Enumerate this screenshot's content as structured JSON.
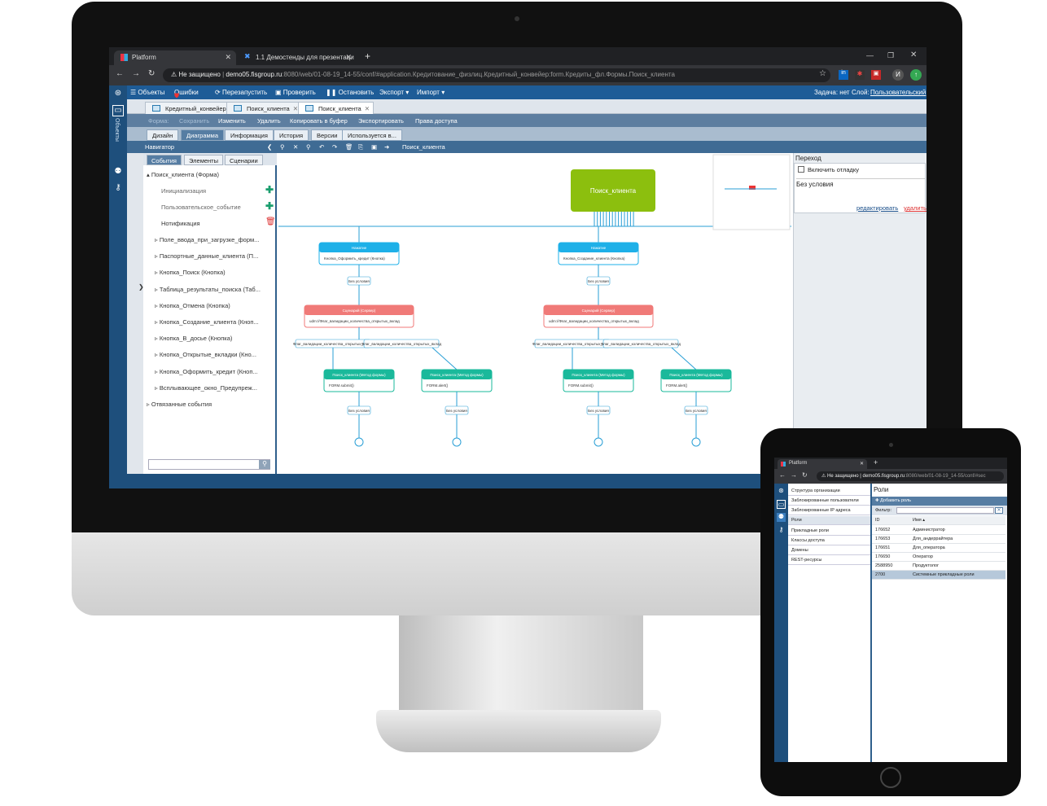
{
  "browser": {
    "tabs": [
      {
        "label": "Platform"
      },
      {
        "label": "1.1 Демостенды для презентаци"
      }
    ],
    "new_tab": "+",
    "security": "Не защищено",
    "url_host": "demo05.fisgroup.ru",
    "url_rest": ":8080/web/01-08-19_14-55/conf/#application.Кредитование_физлиц.Кредитный_конвейер:form.Кредиты_фл.Формы.Поиск_клиента",
    "profile_initial": "И"
  },
  "app": {
    "rail_label": "Объекты",
    "top_menu": [
      "Объекты",
      "Ошибки",
      "Перезапустить",
      "Проверить",
      "Остановить",
      "Экспорт",
      "Импорт"
    ],
    "task_label": "Задача: нет",
    "layer_label": "Слой:",
    "layer_value": "Пользовательский",
    "doc_tabs": [
      "Кредитный_конвейер",
      "Поиск_клиента",
      "Поиск_клиента"
    ],
    "actions": [
      "Форма:",
      "Сохранить",
      "Изменить",
      "Удалить",
      "Копировать в буфер",
      "Экспортировать",
      "Права доступа"
    ],
    "sub_tabs": [
      "Дизайн",
      "Диаграмма",
      "Информация",
      "История",
      "Версии",
      "Используется в..."
    ],
    "navigator_label": "Навигатор",
    "breadcrumb": "Поиск_клиента",
    "left_tabs": [
      "События",
      "Элементы",
      "Сценарии"
    ],
    "tree": {
      "root": "Поиск_клиента (Форма)",
      "events": [
        "Инициализация",
        "Пользовательское_событие",
        "Нотификация"
      ],
      "items": [
        "Поле_ввода_при_загрузке_форм...",
        "Паспортные_данные_клиента (П...",
        "Кнопка_Поиск (Кнопка)",
        "Таблица_результаты_поиска (Таб...",
        "Кнопка_Отмена (Кнопка)",
        "Кнопка_Создание_клиента (Кноп...",
        "Кнопка_В_досье (Кнопка)",
        "Кнопка_Открытые_вкладки (Кно...",
        "Кнопка_Оформить_кредит (Кноп...",
        "Всплывающее_окно_Предупреж..."
      ],
      "bound_events": "Отвязанные события"
    },
    "diagram": {
      "root_node": "Поиск_клиента",
      "click_nodes": [
        {
          "title": "Нажатие",
          "body": "Кнопка_Оформить_кредит (Кнопка)"
        },
        {
          "title": "Нажатие",
          "body": "Кнопка_Создание_клиента (Кнопка)"
        }
      ],
      "cond_label": "Без условия",
      "scenario_title": "Сценарий (Сервер)",
      "scenario_body": "udm://Флаг_валидации_количества_открытых_вклад",
      "branch_label_left": "Флаг_валидации_количества_открытых_вклад",
      "branch_label_right": "Флаг_валидации_количества_открытых_вклад",
      "method_title": "Поиск_клиента (Метод формы)",
      "method_body_a": "FORM.submit()",
      "method_body_b": "FORM.alert()"
    },
    "right_panel": {
      "title": "Переход",
      "debug_checkbox": "Включить отладку",
      "condition": "Без условия",
      "edit_link": "редактировать",
      "delete_link": "удалить"
    }
  },
  "tablet": {
    "tab_label": "Platform",
    "security": "Не защищено",
    "url_host": "demo05.fisgroup.ru",
    "url_rest": ":8080/web/01-08-19_14-55/conf/#sec",
    "sidebar": [
      "Структура организации",
      "Заблокированные пользователи",
      "Заблокированные IP адреса",
      "Роли",
      "Прикладные роли",
      "Классы доступа",
      "Домены",
      "REST-ресурсы"
    ],
    "title": "Роли",
    "add_button": "Добавить роль",
    "filter_label": "Фильтр:",
    "columns": [
      "ID",
      "Имя"
    ],
    "rows": [
      {
        "id": "176652",
        "name": "Администратор"
      },
      {
        "id": "176653",
        "name": "Для_андеррайтера"
      },
      {
        "id": "176651",
        "name": "Для_оператора"
      },
      {
        "id": "176650",
        "name": "Оператор"
      },
      {
        "id": "2588950",
        "name": "Продуктолог"
      },
      {
        "id": "2700",
        "name": "Системные прикладные роли"
      }
    ]
  },
  "colors": {
    "app_header": "#1e5c97",
    "root_node": "#8cbf0e",
    "click_node": "#1eb0e8",
    "scenario_node": "#f07a78",
    "method_node": "#1ab99b",
    "edge": "#2a9fd6"
  }
}
